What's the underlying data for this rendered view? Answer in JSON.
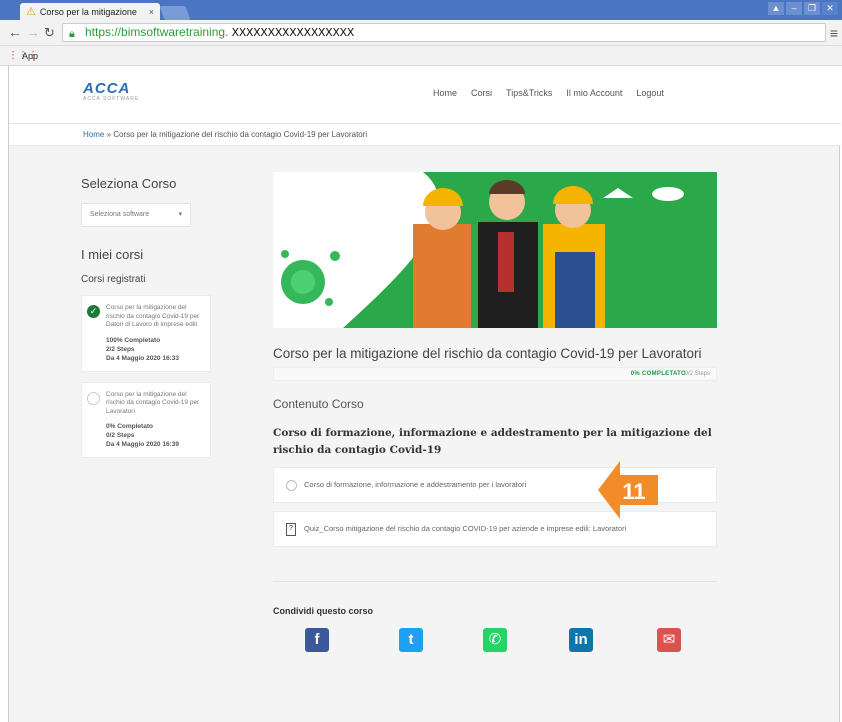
{
  "browser": {
    "tab_title": "Corso per la mitigazione",
    "tab_close": "×",
    "url_secure": "https://bimsoftwaretraining.",
    "url_host": "XXXXXXXXXXXXXXXXX",
    "bookmarks_label": "App"
  },
  "header": {
    "logo_text": "ACCA",
    "logo_sub": "ACCA SOFTWARE",
    "nav": [
      "Home",
      "Corsi",
      "Tips&Tricks",
      "Il mio Account",
      "Logout"
    ]
  },
  "breadcrumb": {
    "home": "Home",
    "separator": "»",
    "current": "Corso per la mitigazione del rischio da contagio Covid-19 per Lavoratori"
  },
  "sidebar": {
    "select_heading": "Seleziona Corso",
    "select_value": "Seleziona software",
    "my_courses_heading": "I miei corsi",
    "registered_heading": "Corsi registrati",
    "courses": [
      {
        "title": "Corso per la mitigazione del rischio da contagio Covid-19 per Datori di Lavoro di imprese edili",
        "status": "100% Completato",
        "steps": "2/2 Steps",
        "date": "Da 4 Maggio 2020 16:33",
        "completed": true
      },
      {
        "title": "Corso per la mitigazione del rischio da contagio Covid-19 per Lavoratori",
        "status": "0% Completato",
        "steps": "0/2 Steps",
        "date": "Da 4 Maggio 2020 16:39",
        "completed": false
      }
    ]
  },
  "main": {
    "heading": "Corso per la mitigazione del rischio da contagio Covid-19 per Lavoratori",
    "progress_label": "0% COMPLETATO",
    "progress_steps": "0/2 Steps",
    "progress_fraction": 0,
    "content_heading": "Contenuto Corso",
    "section_title": "Corso di formazione, informazione e addestramento per la mitigazione del rischio da contagio Covid-19",
    "lessons": [
      {
        "label": "Corso di formazione, informazione e addestramento per i lavoratori",
        "type": "lesson"
      },
      {
        "label": "Quiz_Corso mitigazione del rischio da contagio COVID-19 per aziende e imprese edili: Lavoratori",
        "type": "quiz"
      }
    ],
    "share_heading": "Condividi questo corso",
    "share": [
      {
        "network": "facebook-icon",
        "glyph": "f",
        "color": "#3b5998"
      },
      {
        "network": "twitter-icon",
        "glyph": "t",
        "color": "#1da1f2"
      },
      {
        "network": "whatsapp-icon",
        "glyph": "✆",
        "color": "#25d366"
      },
      {
        "network": "linkedin-icon",
        "glyph": "in",
        "color": "#0e76a8"
      },
      {
        "network": "email-icon",
        "glyph": "✉",
        "color": "#d9534f"
      }
    ]
  },
  "annotation": {
    "number": "11",
    "color": "#f28c28"
  }
}
